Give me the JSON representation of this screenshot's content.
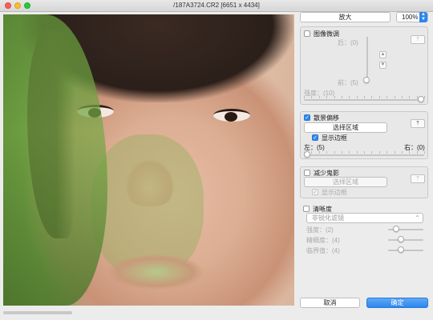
{
  "window": {
    "title": "/187A3724.CR2 [6651 x 4434]"
  },
  "toolbar": {
    "zoom_button": "放大",
    "zoom_value": "100%"
  },
  "image_fine_tune": {
    "title": "图像微调",
    "checked": false,
    "behind_label": "后：(0)",
    "front_label": "前：(5)",
    "strength_label": "强度：(10)",
    "reset_icon": "reset-icon"
  },
  "background_offset": {
    "title": "散景偏移",
    "checked": true,
    "select_area_button": "选择区域",
    "show_border_label": "显示边框",
    "show_border_checked": true,
    "left_label": "左：(5)",
    "right_label": "右：(0)",
    "reset_icon": "reset-icon"
  },
  "reduce_ghosting": {
    "title": "减少鬼影",
    "checked": false,
    "select_area_button": "选择区域",
    "show_border_label": "显示边框",
    "show_border_checked": true,
    "reset_icon": "reset-icon"
  },
  "sharpness": {
    "title": "清晰度",
    "checked": false,
    "mode_select": "非锐化滤镜",
    "strength_label": "强度：(2)",
    "fineness_label": "精细度：(4)",
    "threshold_label": "临界值：(4)"
  },
  "footer": {
    "cancel_button": "取消",
    "ok_button": "确定"
  },
  "colors": {
    "accent": "#2d86ef",
    "panel_bg": "#ececec"
  }
}
